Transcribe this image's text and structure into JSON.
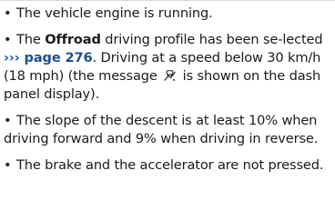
{
  "bullets": {
    "b1": {
      "bullet": "•",
      "text": "The vehicle engine is running."
    },
    "b2": {
      "bullet": "•",
      "pre": "The ",
      "bold": "Offroad",
      "mid": " driving profile has been se-lected ",
      "link": "››› page 276",
      "post_link": ". Driving at a speed below 30 km/h (18 mph) (the message ",
      "icon": "hill-descent-icon",
      "post_icon": " is shown on the dash panel display)."
    },
    "b3": {
      "bullet": "•",
      "text": "The slope of the descent is at least 10% when driving forward and 9% when driving in reverse."
    },
    "b4": {
      "bullet": "•",
      "text": "The brake and the accelerator are not pressed."
    }
  },
  "colors": {
    "text": "#1a1a1a",
    "link": "#1f4f8f"
  }
}
